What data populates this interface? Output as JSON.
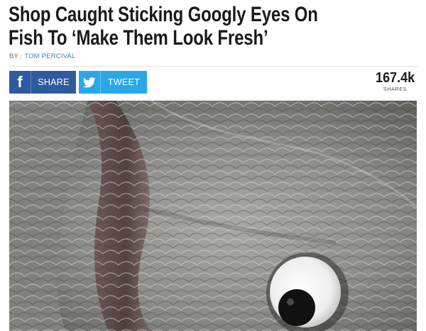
{
  "article": {
    "title": "Shop Caught Sticking Googly Eyes On Fish To ‘Make Them Look Fresh’",
    "byline_prefix": "BY : ",
    "author": "TOM PERCIVAL"
  },
  "share_bar": {
    "facebook_label": "SHARE",
    "twitter_label": "TWEET",
    "share_count": "167.4k",
    "share_caption": "SHARES",
    "facebook_color": "#2e5aa0",
    "twitter_color": "#28a8e9"
  },
  "icons": {
    "facebook": "facebook-icon",
    "twitter": "twitter-bird-icon"
  },
  "colors": {
    "author_link": "#3b82c4",
    "headline": "#1a1a1a"
  }
}
